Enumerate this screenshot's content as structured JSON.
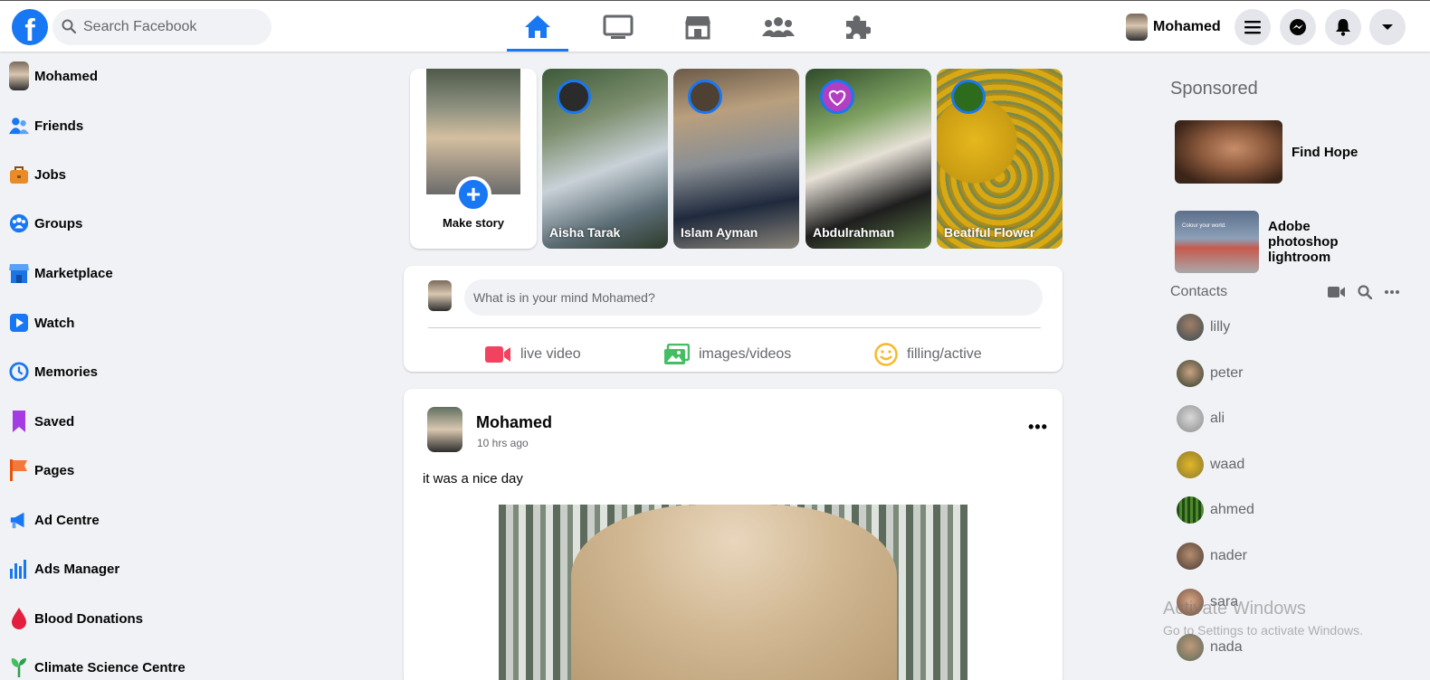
{
  "header": {
    "logo": "f",
    "search_placeholder": "Search Facebook",
    "nav_tabs": [
      "home-icon",
      "watch-icon",
      "marketplace-icon",
      "groups-icon",
      "gaming-icon"
    ],
    "profile_name": "Mohamed",
    "actions": [
      "menu-icon",
      "messenger-icon",
      "bell-icon",
      "dropdown-icon"
    ]
  },
  "sidebar": {
    "items": [
      {
        "label": "Mohamed"
      },
      {
        "label": "Friends"
      },
      {
        "label": "Jobs"
      },
      {
        "label": "Groups"
      },
      {
        "label": "Marketplace"
      },
      {
        "label": "Watch"
      },
      {
        "label": "Memories"
      },
      {
        "label": "Saved"
      },
      {
        "label": "Pages"
      },
      {
        "label": "Ad Centre"
      },
      {
        "label": "Ads Manager"
      },
      {
        "label": "Blood Donations"
      },
      {
        "label": "Climate Science Centre"
      }
    ]
  },
  "stories": {
    "make_story_label": "Make story",
    "items": [
      {
        "name": "Aisha Tarak"
      },
      {
        "name": "Islam Ayman"
      },
      {
        "name": "Abdulrahman"
      },
      {
        "name": "Beatiful Flower"
      }
    ]
  },
  "composer": {
    "placeholder": "What is in your mind Mohamed?",
    "actions": [
      {
        "label": "live video",
        "icon": "video-camera-icon",
        "color": "#f3425f"
      },
      {
        "label": "images/videos",
        "icon": "photo-icon",
        "color": "#45bd62"
      },
      {
        "label": "filling/active",
        "icon": "smiley-icon",
        "color": "#f7b928"
      }
    ]
  },
  "post": {
    "author": "Mohamed",
    "time": "10 hrs ago",
    "more": "•••",
    "text": "it was a nice day"
  },
  "right": {
    "sponsored_title": "Sponsored",
    "ads": [
      {
        "label": "Find Hope"
      },
      {
        "label": "Adobe photoshop lightroom",
        "image_text": "Colour your world."
      }
    ],
    "contacts_title": "Contacts",
    "contacts": [
      "lilly",
      "peter",
      "ali",
      "waad",
      "ahmed",
      "nader",
      "sara",
      "nada"
    ]
  },
  "watermark": {
    "line1": "Activate Windows",
    "line2": "Go to Settings to activate Windows."
  },
  "colors": {
    "brand": "#1877f2",
    "background": "#f0f2f5"
  }
}
